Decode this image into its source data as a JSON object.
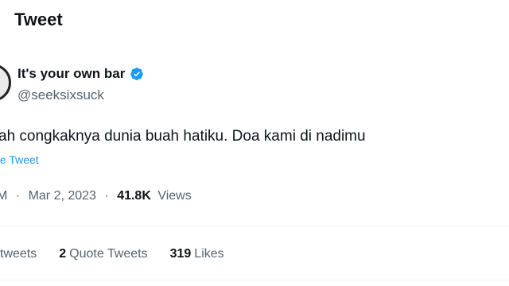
{
  "header": {
    "title": "Tweet"
  },
  "author": {
    "display_name": "It's your own bar",
    "handle": "@seeksixsuck",
    "verified_color": "#1d9bf0"
  },
  "tweet": {
    "text": "ah congkaknya dunia buah hatiku. Doa kami di nadimu",
    "quote_link": "te Tweet"
  },
  "meta": {
    "time": "M",
    "separator": "·",
    "date": "Mar 2, 2023",
    "views_count": "41.8K",
    "views_label": "Views"
  },
  "stats": [
    {
      "num": "",
      "label": "tweets"
    },
    {
      "num": "2",
      "label": "Quote Tweets"
    },
    {
      "num": "319",
      "label": "Likes"
    }
  ]
}
